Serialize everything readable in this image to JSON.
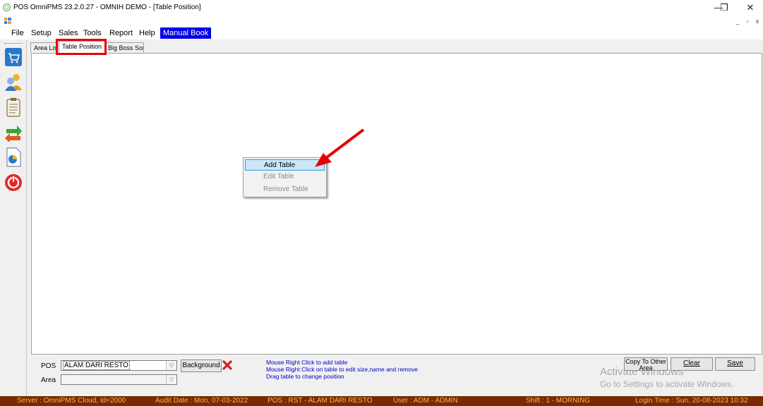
{
  "window": {
    "title": "POS OmniPMS 23.2.0.27 - OMNIH DEMO - [Table Position]",
    "controls": {
      "minimize": "—",
      "restore": "❐",
      "close": "✕"
    },
    "child_controls": {
      "minimize": "_",
      "restore": "▫",
      "close": "x"
    }
  },
  "menu": {
    "items": [
      "File",
      "Setup",
      "Sales",
      "Tools",
      "Report",
      "Help"
    ],
    "highlight_item": "Manual Book",
    "highlight_color": "#0000e6"
  },
  "left_toolbar": {
    "icons": [
      "cart-icon",
      "users-icon",
      "clipboard-icon",
      "exchange-icon",
      "report-icon",
      "power-icon"
    ]
  },
  "tabs": [
    "Area List",
    "Table Position",
    "Big Boss Sort"
  ],
  "active_tab": "Table Position",
  "context_menu": {
    "items": [
      {
        "label": "Add Table",
        "enabled": true,
        "highlighted": true
      },
      {
        "label": "Edit Table",
        "enabled": false
      },
      {
        "label": "Remove Table",
        "enabled": false
      }
    ]
  },
  "bottom": {
    "pos_label": "POS",
    "pos_value": "ALAM DARI RESTO",
    "area_label": "Area",
    "area_value": "",
    "background_button": "Background",
    "hints": [
      "Mouse Right Click to add table",
      "Mouse Right Click on table to edit size,name and remove",
      "Drag table to change position"
    ],
    "copy_button": "Copy To Other Area",
    "clear_button": "Clear",
    "save_button": "Save"
  },
  "watermark": {
    "line1": "Activate Windows",
    "line2": "Go to Settings to activate Windows."
  },
  "status_bar": {
    "server": "Server : OmniPMS Cloud, Id=2000",
    "audit_date": "Audit Date : Mon, 07-03-2022",
    "pos": "POS : RST - ALAM DARI RESTO",
    "user": "User : ADM - ADMIN",
    "shift": "Shift : 1 - MORNING",
    "login_time": "Login Time : Sun, 20-08-2023 10:32"
  },
  "colors": {
    "status_bg": "#7a2a00",
    "status_text": "#f5b56a",
    "annotation_red": "#e60000",
    "hint_blue": "#0000cc"
  }
}
